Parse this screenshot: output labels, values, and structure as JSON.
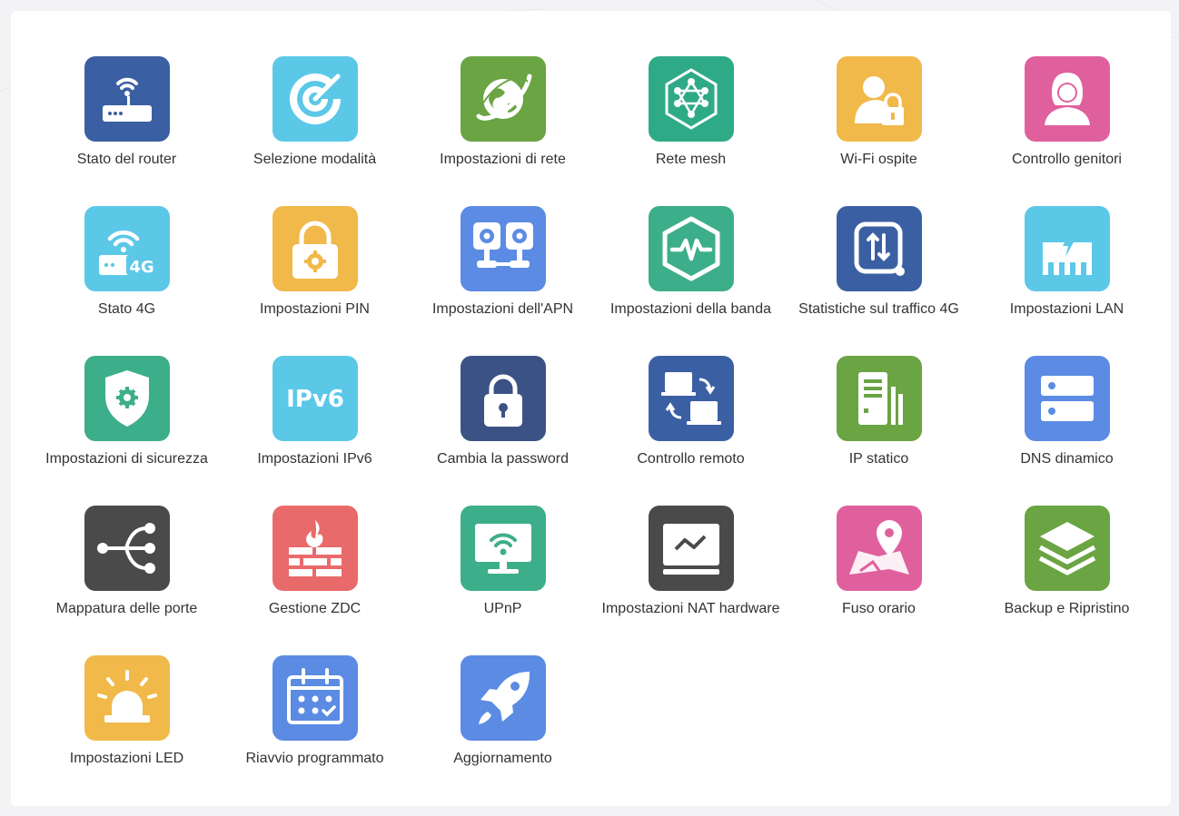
{
  "tiles": [
    {
      "label": "Stato del router",
      "icon": "router-icon",
      "color": "#3B5FA3"
    },
    {
      "label": "Selezione modalità",
      "icon": "mode-radar-icon",
      "color": "#5CC8E8"
    },
    {
      "label": "Impostazioni di rete",
      "icon": "globe-network-icon",
      "color": "#6BA443"
    },
    {
      "label": "Rete mesh",
      "icon": "mesh-icon",
      "color": "#2FAA86"
    },
    {
      "label": "Wi-Fi ospite",
      "icon": "guest-lock-icon",
      "color": "#F1B94A"
    },
    {
      "label": "Controllo genitori",
      "icon": "parent-user-icon",
      "color": "#E0609E"
    },
    {
      "label": "Stato 4G",
      "icon": "router-4g-icon",
      "color": "#5CC8E8"
    },
    {
      "label": "Impostazioni PIN",
      "icon": "pin-lock-gear-icon",
      "color": "#F1B94A"
    },
    {
      "label": "Impostazioni dell'APN",
      "icon": "apn-gears-icon",
      "color": "#5B8BE3"
    },
    {
      "label": "Impostazioni della banda",
      "icon": "band-pulse-icon",
      "color": "#3DAE8A"
    },
    {
      "label": "Statistiche sul traffico 4G",
      "icon": "traffic-stats-icon",
      "color": "#3B5FA3"
    },
    {
      "label": "Impostazioni LAN",
      "icon": "lan-port-icon",
      "color": "#5CC8E8"
    },
    {
      "label": "Impostazioni di sicurezza",
      "icon": "shield-gear-icon",
      "color": "#3DAE8A"
    },
    {
      "label": "Impostazioni IPv6",
      "icon": "ipv6-icon",
      "color": "#5CC8E8",
      "text": "IPv6"
    },
    {
      "label": "Cambia la password",
      "icon": "padlock-icon",
      "color": "#3B5384"
    },
    {
      "label": "Controllo remoto",
      "icon": "remote-control-icon",
      "color": "#3B5FA3"
    },
    {
      "label": "IP statico",
      "icon": "static-ip-icon",
      "color": "#6BA443"
    },
    {
      "label": "DNS dinamico",
      "icon": "dns-server-icon",
      "color": "#5B8BE3"
    },
    {
      "label": "Mappatura delle porte",
      "icon": "port-mapping-icon",
      "color": "#4A4A4A"
    },
    {
      "label": "Gestione ZDC",
      "icon": "firewall-icon",
      "color": "#E96A6A"
    },
    {
      "label": "UPnP",
      "icon": "upnp-monitor-icon",
      "color": "#3DAE8A"
    },
    {
      "label": "Impostazioni NAT hardware",
      "icon": "nat-monitor-icon",
      "color": "#4A4A4A"
    },
    {
      "label": "Fuso orario",
      "icon": "map-pin-icon",
      "color": "#E0609E"
    },
    {
      "label": "Backup e Ripristino",
      "icon": "layers-icon",
      "color": "#6BA443"
    },
    {
      "label": "Impostazioni LED",
      "icon": "led-alarm-icon",
      "color": "#F1B94A"
    },
    {
      "label": "Riavvio programmato",
      "icon": "calendar-icon",
      "color": "#5B8BE3"
    },
    {
      "label": "Aggiornamento",
      "icon": "rocket-icon",
      "color": "#5B8BE3"
    }
  ]
}
